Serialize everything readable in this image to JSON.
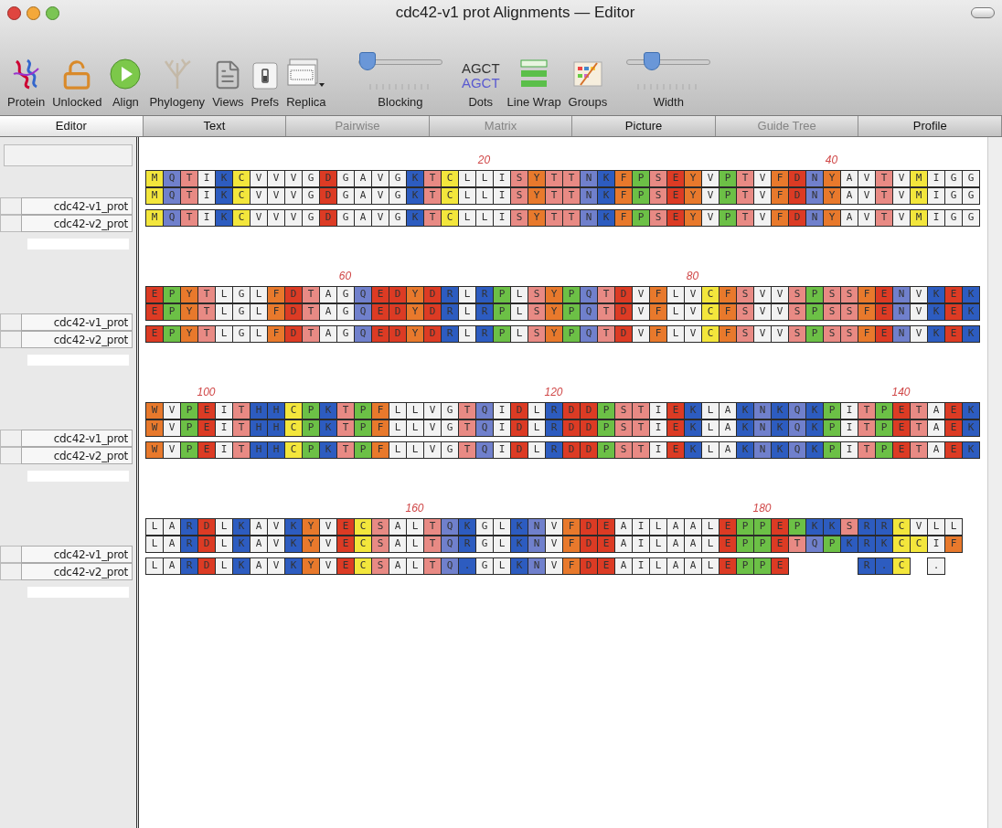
{
  "window": {
    "title": "cdc42-v1 prot Alignments — Editor"
  },
  "toolbar": [
    {
      "label": "Protein",
      "kind": "button",
      "disabled": false
    },
    {
      "label": "Unlocked",
      "kind": "button",
      "disabled": false
    },
    {
      "label": "Align",
      "kind": "button",
      "disabled": false
    },
    {
      "label": "Phylogeny",
      "kind": "button",
      "disabled": true
    },
    {
      "label": "Views",
      "kind": "button",
      "disabled": false
    },
    {
      "label": "Prefs",
      "kind": "button",
      "disabled": false
    },
    {
      "label": "Replica",
      "kind": "button",
      "disabled": false
    },
    {
      "label": "Blocking",
      "kind": "slider",
      "level": 0.1
    },
    {
      "label": "Dots",
      "kind": "text_icon",
      "lines": [
        "AGCT",
        "AGCT"
      ]
    },
    {
      "label": "Line Wrap",
      "kind": "button",
      "disabled": false
    },
    {
      "label": "Groups",
      "kind": "button",
      "disabled": false
    },
    {
      "label": "Width",
      "kind": "slider",
      "level": 0.3
    }
  ],
  "tabs": [
    {
      "label": "Editor",
      "selected": true,
      "disabled": false
    },
    {
      "label": "Text",
      "selected": false,
      "disabled": false
    },
    {
      "label": "Pairwise",
      "selected": false,
      "disabled": true
    },
    {
      "label": "Matrix",
      "selected": false,
      "disabled": true
    },
    {
      "label": "Picture",
      "selected": false,
      "disabled": false
    },
    {
      "label": "Guide Tree",
      "selected": false,
      "disabled": true
    },
    {
      "label": "Profile",
      "selected": false,
      "disabled": false
    }
  ],
  "blocks": [
    {
      "ruler": [
        {
          "label": "20"
        },
        {
          "label": "40"
        }
      ],
      "sequences": [
        {
          "name": "cdc42-v1_prot",
          "residues": [
            "M",
            "Q",
            "T",
            "I",
            "K",
            "C",
            "V",
            "V",
            "V",
            "G",
            "D",
            "G",
            "A",
            "V",
            "G",
            "K",
            "T",
            "C",
            "L",
            "L",
            "I",
            "S",
            "Y",
            "T",
            "T",
            "N",
            "K",
            "F",
            "P",
            "S",
            "E",
            "Y",
            "V",
            "P",
            "T",
            "V",
            "F",
            "D",
            "N",
            "Y",
            "A",
            "V",
            "T",
            "V",
            "M",
            "I",
            "G",
            "G"
          ]
        },
        {
          "name": "cdc42-v2_prot",
          "residues": [
            "M",
            "Q",
            "T",
            "I",
            "K",
            "C",
            "V",
            "V",
            "V",
            "G",
            "D",
            "G",
            "A",
            "V",
            "G",
            "K",
            "T",
            "C",
            "L",
            "L",
            "I",
            "S",
            "Y",
            "T",
            "T",
            "N",
            "K",
            "F",
            "P",
            "S",
            "E",
            "Y",
            "V",
            "P",
            "T",
            "V",
            "F",
            "D",
            "N",
            "Y",
            "A",
            "V",
            "T",
            "V",
            "M",
            "I",
            "G",
            "G"
          ]
        }
      ],
      "consensus": {
        "residues": [
          "M",
          "Q",
          "T",
          "I",
          "K",
          "C",
          "V",
          "V",
          "V",
          "G",
          "D",
          "G",
          "A",
          "V",
          "G",
          "K",
          "T",
          "C",
          "L",
          "L",
          "I",
          "S",
          "Y",
          "T",
          "T",
          "N",
          "K",
          "F",
          "P",
          "S",
          "E",
          "Y",
          "V",
          "P",
          "T",
          "V",
          "F",
          "D",
          "N",
          "Y",
          "A",
          "V",
          "T",
          "V",
          "M",
          "I",
          "G",
          "G"
        ]
      }
    },
    {
      "ruler": [
        {
          "label": "60"
        },
        {
          "label": "80"
        }
      ],
      "sequences": [
        {
          "name": "cdc42-v1_prot",
          "residues": [
            "E",
            "P",
            "Y",
            "T",
            "L",
            "G",
            "L",
            "F",
            "D",
            "T",
            "A",
            "G",
            "Q",
            "E",
            "D",
            "Y",
            "D",
            "R",
            "L",
            "R",
            "P",
            "L",
            "S",
            "Y",
            "P",
            "Q",
            "T",
            "D",
            "V",
            "F",
            "L",
            "V",
            "C",
            "F",
            "S",
            "V",
            "V",
            "S",
            "P",
            "S",
            "S",
            "F",
            "E",
            "N",
            "V",
            "K",
            "E",
            "K"
          ]
        },
        {
          "name": "cdc42-v2_prot",
          "residues": [
            "E",
            "P",
            "Y",
            "T",
            "L",
            "G",
            "L",
            "F",
            "D",
            "T",
            "A",
            "G",
            "Q",
            "E",
            "D",
            "Y",
            "D",
            "R",
            "L",
            "R",
            "P",
            "L",
            "S",
            "Y",
            "P",
            "Q",
            "T",
            "D",
            "V",
            "F",
            "L",
            "V",
            "C",
            "F",
            "S",
            "V",
            "V",
            "S",
            "P",
            "S",
            "S",
            "F",
            "E",
            "N",
            "V",
            "K",
            "E",
            "K"
          ]
        }
      ],
      "consensus": {
        "residues": [
          "E",
          "P",
          "Y",
          "T",
          "L",
          "G",
          "L",
          "F",
          "D",
          "T",
          "A",
          "G",
          "Q",
          "E",
          "D",
          "Y",
          "D",
          "R",
          "L",
          "R",
          "P",
          "L",
          "S",
          "Y",
          "P",
          "Q",
          "T",
          "D",
          "V",
          "F",
          "L",
          "V",
          "C",
          "F",
          "S",
          "V",
          "V",
          "S",
          "P",
          "S",
          "S",
          "F",
          "E",
          "N",
          "V",
          "K",
          "E",
          "K"
        ]
      }
    },
    {
      "ruler": [
        {
          "label": "100"
        },
        {
          "label": "120"
        },
        {
          "label": "140"
        }
      ],
      "sequences": [
        {
          "name": "cdc42-v1_prot",
          "residues": [
            "W",
            "V",
            "P",
            "E",
            "I",
            "T",
            "H",
            "H",
            "C",
            "P",
            "K",
            "T",
            "P",
            "F",
            "L",
            "L",
            "V",
            "G",
            "T",
            "Q",
            "I",
            "D",
            "L",
            "R",
            "D",
            "D",
            "P",
            "S",
            "T",
            "I",
            "E",
            "K",
            "L",
            "A",
            "K",
            "N",
            "K",
            "Q",
            "K",
            "P",
            "I",
            "T",
            "P",
            "E",
            "T",
            "A",
            "E",
            "K"
          ]
        },
        {
          "name": "cdc42-v2_prot",
          "residues": [
            "W",
            "V",
            "P",
            "E",
            "I",
            "T",
            "H",
            "H",
            "C",
            "P",
            "K",
            "T",
            "P",
            "F",
            "L",
            "L",
            "V",
            "G",
            "T",
            "Q",
            "I",
            "D",
            "L",
            "R",
            "D",
            "D",
            "P",
            "S",
            "T",
            "I",
            "E",
            "K",
            "L",
            "A",
            "K",
            "N",
            "K",
            "Q",
            "K",
            "P",
            "I",
            "T",
            "P",
            "E",
            "T",
            "A",
            "E",
            "K"
          ]
        }
      ],
      "consensus": {
        "residues": [
          "W",
          "V",
          "P",
          "E",
          "I",
          "T",
          "H",
          "H",
          "C",
          "P",
          "K",
          "T",
          "P",
          "F",
          "L",
          "L",
          "V",
          "G",
          "T",
          "Q",
          "I",
          "D",
          "L",
          "R",
          "D",
          "D",
          "P",
          "S",
          "T",
          "I",
          "E",
          "K",
          "L",
          "A",
          "K",
          "N",
          "K",
          "Q",
          "K",
          "P",
          "I",
          "T",
          "P",
          "E",
          "T",
          "A",
          "E",
          "K"
        ]
      }
    },
    {
      "ruler": [
        {
          "label": "160"
        },
        {
          "label": "180"
        }
      ],
      "sequences": [
        {
          "name": "cdc42-v1_prot",
          "residues": [
            "L",
            "A",
            "R",
            "D",
            "L",
            "K",
            "A",
            "V",
            "K",
            "Y",
            "V",
            "E",
            "C",
            "S",
            "A",
            "L",
            "T",
            "Q",
            "K",
            "G",
            "L",
            "K",
            "N",
            "V",
            "F",
            "D",
            "E",
            "A",
            "I",
            "L",
            "A",
            "A",
            "L",
            "E",
            "P",
            "P",
            "E",
            "P",
            "K",
            "K",
            "S",
            "R",
            "R",
            "C",
            "V",
            "L",
            "L"
          ]
        },
        {
          "name": "cdc42-v2_prot",
          "residues": [
            "L",
            "A",
            "R",
            "D",
            "L",
            "K",
            "A",
            "V",
            "K",
            "Y",
            "V",
            "E",
            "C",
            "S",
            "A",
            "L",
            "T",
            "Q",
            "R",
            "G",
            "L",
            "K",
            "N",
            "V",
            "F",
            "D",
            "E",
            "A",
            "I",
            "L",
            "A",
            "A",
            "L",
            "E",
            "P",
            "P",
            "E",
            "T",
            "Q",
            "P",
            "K",
            "R",
            "K",
            "C",
            "C",
            "I",
            "F"
          ]
        }
      ],
      "consensus": {
        "cells": [
          {
            "kind": "residue",
            "residue": "L"
          },
          {
            "kind": "residue",
            "residue": "A"
          },
          {
            "kind": "residue",
            "residue": "R"
          },
          {
            "kind": "residue",
            "residue": "D"
          },
          {
            "kind": "residue",
            "residue": "L"
          },
          {
            "kind": "residue",
            "residue": "K"
          },
          {
            "kind": "residue",
            "residue": "A"
          },
          {
            "kind": "residue",
            "residue": "V"
          },
          {
            "kind": "residue",
            "residue": "K"
          },
          {
            "kind": "residue",
            "residue": "Y"
          },
          {
            "kind": "residue",
            "residue": "V"
          },
          {
            "kind": "residue",
            "residue": "E"
          },
          {
            "kind": "residue",
            "residue": "C"
          },
          {
            "kind": "residue",
            "residue": "S"
          },
          {
            "kind": "residue",
            "residue": "A"
          },
          {
            "kind": "residue",
            "residue": "L"
          },
          {
            "kind": "residue",
            "residue": "T"
          },
          {
            "kind": "residue",
            "residue": "Q"
          },
          {
            "kind": "similar",
            "residue": ".",
            "color": "#2d5cc0"
          },
          {
            "kind": "residue",
            "residue": "G"
          },
          {
            "kind": "residue",
            "residue": "L"
          },
          {
            "kind": "residue",
            "residue": "K"
          },
          {
            "kind": "residue",
            "residue": "N"
          },
          {
            "kind": "residue",
            "residue": "V"
          },
          {
            "kind": "residue",
            "residue": "F"
          },
          {
            "kind": "residue",
            "residue": "D"
          },
          {
            "kind": "residue",
            "residue": "E"
          },
          {
            "kind": "residue",
            "residue": "A"
          },
          {
            "kind": "residue",
            "residue": "I"
          },
          {
            "kind": "residue",
            "residue": "L"
          },
          {
            "kind": "residue",
            "residue": "A"
          },
          {
            "kind": "residue",
            "residue": "A"
          },
          {
            "kind": "residue",
            "residue": "L"
          },
          {
            "kind": "residue",
            "residue": "E"
          },
          {
            "kind": "residue",
            "residue": "P"
          },
          {
            "kind": "residue",
            "residue": "P"
          },
          {
            "kind": "residue",
            "residue": "E"
          },
          {
            "kind": "gap"
          },
          {
            "kind": "gap"
          },
          {
            "kind": "gap"
          },
          {
            "kind": "gap"
          },
          {
            "kind": "residue",
            "residue": "R"
          },
          {
            "kind": "similar",
            "residue": ".",
            "color": "#2d5cc0"
          },
          {
            "kind": "residue",
            "residue": "C"
          },
          {
            "kind": "gap"
          },
          {
            "kind": "similar",
            "residue": ".",
            "color": "#f2f2f2"
          }
        ]
      }
    }
  ]
}
